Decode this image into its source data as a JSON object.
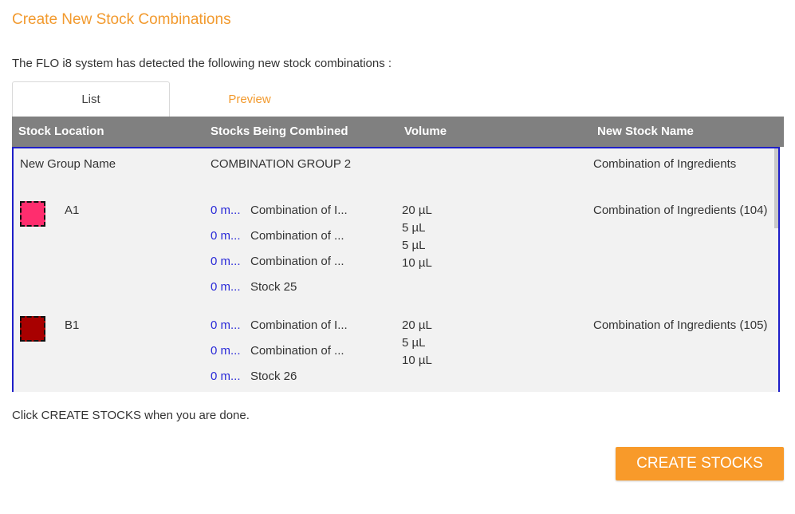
{
  "dialog": {
    "title": "Create New Stock Combinations",
    "intro": "The FLO i8 system has detected the following new stock combinations :",
    "footer_note": "Click CREATE STOCKS when you are done.",
    "create_button": "CREATE STOCKS"
  },
  "tabs": [
    {
      "label": "List",
      "active": true
    },
    {
      "label": "Preview",
      "active": false
    }
  ],
  "columns": [
    "Stock Location",
    "Stocks Being Combined",
    "Volume",
    "New Stock Name"
  ],
  "group": {
    "label": "New Group Name",
    "name": "COMBINATION GROUP 2",
    "new_stock_name": "Combination of Ingredients"
  },
  "rows": [
    {
      "location": "A1",
      "swatch_color": "#ff2d6e",
      "stocks": [
        {
          "qty": "0 m...",
          "name": "Combination of I..."
        },
        {
          "qty": "0 m...",
          "name": "Combination of ..."
        },
        {
          "qty": "0 m...",
          "name": "Combination of ..."
        },
        {
          "qty": "0 m...",
          "name": "Stock 25"
        }
      ],
      "volumes": [
        "20 µL",
        "5 µL",
        "5 µL",
        "10 µL"
      ],
      "new_stock_name": "Combination of Ingredients (104)"
    },
    {
      "location": "B1",
      "swatch_color": "#a80000",
      "stocks": [
        {
          "qty": "0 m...",
          "name": "Combination of I..."
        },
        {
          "qty": "0 m...",
          "name": "Combination of ..."
        },
        {
          "qty": "0 m...",
          "name": "Stock 26"
        }
      ],
      "volumes": [
        "20 µL",
        "5 µL",
        "10 µL"
      ],
      "new_stock_name": "Combination of Ingredients (105)"
    }
  ],
  "colors": {
    "accent": "#f29a2e",
    "button": "#f89a2a",
    "header_bg": "#808080",
    "table_border": "#1e1ec8",
    "qty_text": "#2a2ad8"
  }
}
